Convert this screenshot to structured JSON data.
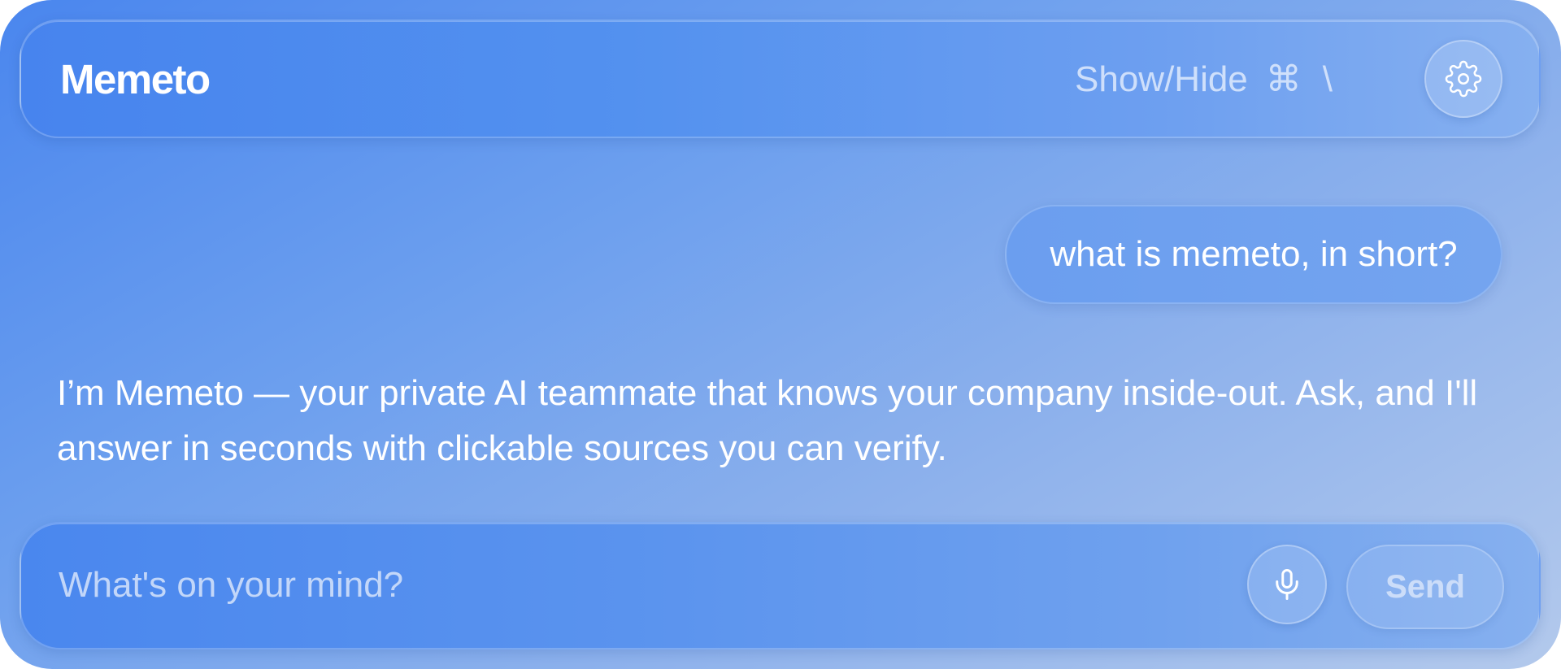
{
  "app": {
    "title": "Memeto"
  },
  "header": {
    "shortcut_label": "Show/Hide",
    "shortcut_key_1": "⌘",
    "shortcut_key_2": "\\",
    "settings_icon": "gear-icon"
  },
  "conversation": {
    "user_message": "what is memeto, in short?",
    "assistant_message": "I’m Memeto — your private AI teammate that knows your company inside-out. Ask, and I'll answer in seconds with clickable sources you can verify."
  },
  "composer": {
    "placeholder": "What's on your mind?",
    "value": "",
    "mic_icon": "microphone-icon",
    "send_label": "Send"
  },
  "colors": {
    "accent": "#4a86ee",
    "text": "#ffffff"
  }
}
